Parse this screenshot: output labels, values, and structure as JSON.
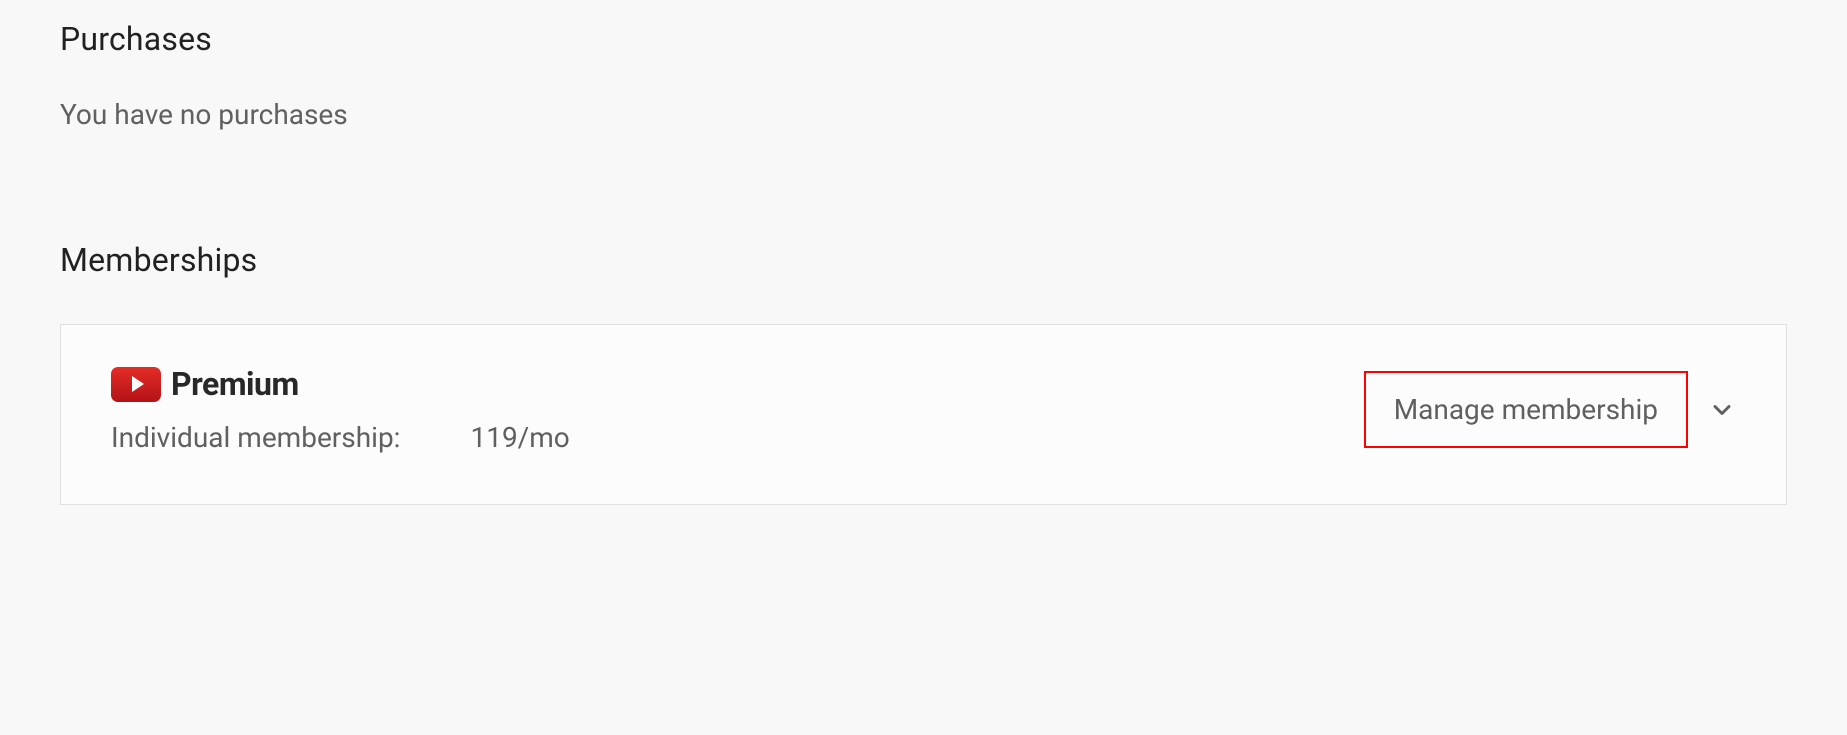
{
  "purchases": {
    "heading": "Purchases",
    "empty_message": "You have no purchases"
  },
  "memberships": {
    "heading": "Memberships",
    "items": [
      {
        "brand": "Premium",
        "type_label": "Individual membership:",
        "price": "119/mo",
        "manage_label": "Manage membership"
      }
    ]
  },
  "colors": {
    "highlight_border": "#ff0000",
    "youtube_red_top": "#e52d27",
    "youtube_red_bottom": "#b31217"
  }
}
